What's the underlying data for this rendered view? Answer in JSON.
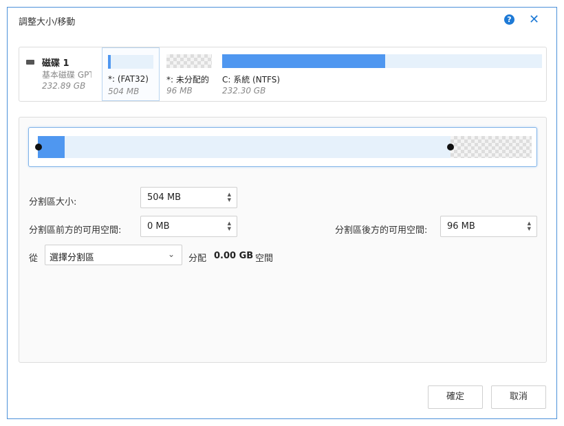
{
  "window": {
    "title": "調整大小/移動"
  },
  "disk": {
    "name": "磁碟 1",
    "type": "基本磁碟 GPT",
    "size": "232.89 GB",
    "partitions": [
      {
        "label": "*:  (FAT32)",
        "size": "504 MB",
        "used_fraction": 0.06,
        "selected": true
      },
      {
        "label": "*: 未分配的",
        "size": "96 MB",
        "unallocated": true
      },
      {
        "label": "C: 系統 (NTFS)",
        "size": "232.30 GB",
        "used_fraction": 0.51
      }
    ]
  },
  "resize": {
    "used_fraction": 0.055,
    "free_after_fraction": 0.165
  },
  "form": {
    "partition_size_label": "分割區大小:",
    "partition_size_value": "504 MB",
    "before_label": "分割區前方的可用空間:",
    "before_value": "0 MB",
    "after_label": "分割區後方的可用空間:",
    "after_value": "96 MB",
    "from_label": "從",
    "from_select": "選擇分割區",
    "allocate_label": "分配",
    "allocate_value": "0.00 GB",
    "space_label": "空間"
  },
  "buttons": {
    "ok": "確定",
    "cancel": "取消"
  },
  "icons": {
    "help": "help-icon",
    "close": "close-icon",
    "disk": "disk-icon"
  },
  "colors": {
    "accent": "#1e7ad6",
    "used": "#4f97f0",
    "track": "#e6f1fb"
  }
}
